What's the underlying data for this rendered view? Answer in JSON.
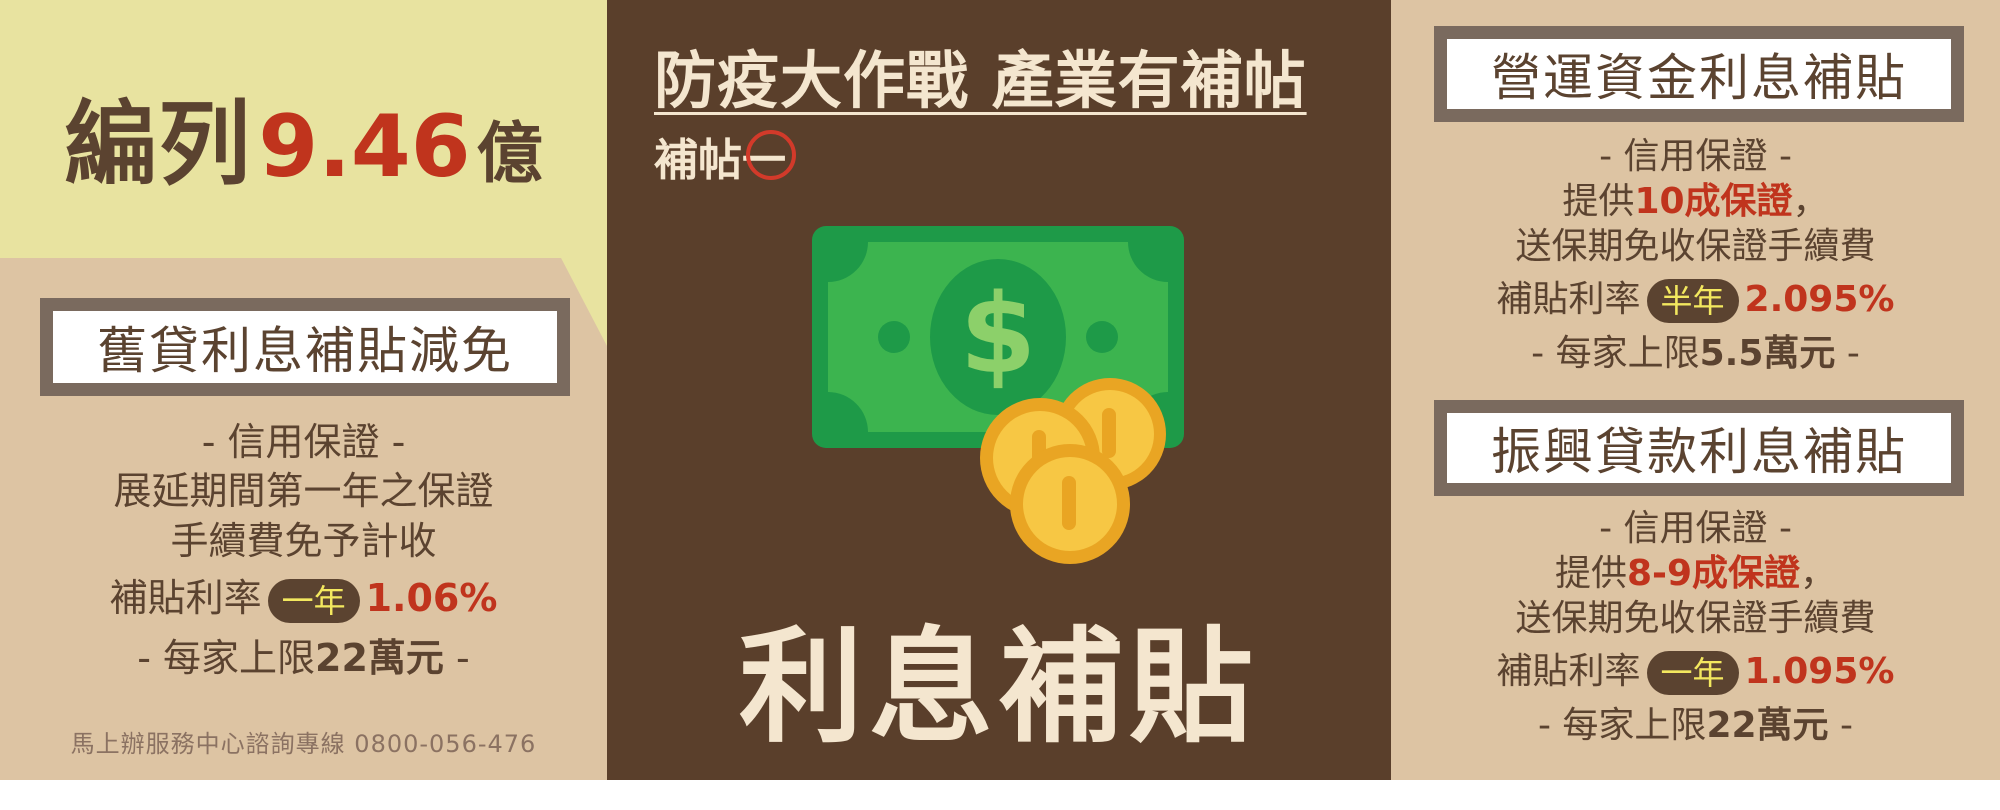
{
  "left": {
    "budget_prefix": "編列",
    "budget_amount": "9.46",
    "budget_suffix": "億",
    "box_title": "舊貸利息補貼減免",
    "line1": "- 信用保證 -",
    "line2": "展延期間第一年之保證",
    "line3": "手續費免予計收",
    "rate_label": "補貼利率",
    "rate_badge": "一年",
    "rate_value": "1.06%",
    "cap_prefix": "- 每家上限",
    "cap_value": "22萬元",
    "cap_suffix": " -",
    "footer": "馬上辦服務中心諮詢專線 0800-056-476"
  },
  "center": {
    "title": "防疫大作戰 產業有補帖",
    "subtitle_prefix": "補帖",
    "subtitle_circled": "一",
    "label": "利息補貼",
    "icon": "money-bill-coins-icon"
  },
  "right": {
    "section1": {
      "box_title": "營運資金利息補貼",
      "line1": "- 信用保證 -",
      "line2_prefix": "提供",
      "line2_highlight": "10成保證",
      "line2_suffix": "，",
      "line3": "送保期免收保證手續費",
      "rate_label": "補貼利率",
      "rate_badge": "半年",
      "rate_value": "2.095%",
      "cap_prefix": "- 每家上限",
      "cap_value": "5.5萬元",
      "cap_suffix": " -"
    },
    "section2": {
      "box_title": "振興貸款利息補貼",
      "line1": "- 信用保證 -",
      "line2_prefix": "提供",
      "line2_highlight": "8-9成保證",
      "line2_suffix": "，",
      "line3": "送保期免收保證手續費",
      "rate_label": "補貼利率",
      "rate_badge": "一年",
      "rate_value": "1.095%",
      "cap_prefix": "- 每家上限",
      "cap_value": "22萬元",
      "cap_suffix": " -"
    }
  },
  "colors": {
    "brown": "#5a3f2b",
    "tan": "#ddc4a3",
    "yellow": "#e8e3a0",
    "red": "#c0341d",
    "badge_text": "#f3e85f"
  }
}
